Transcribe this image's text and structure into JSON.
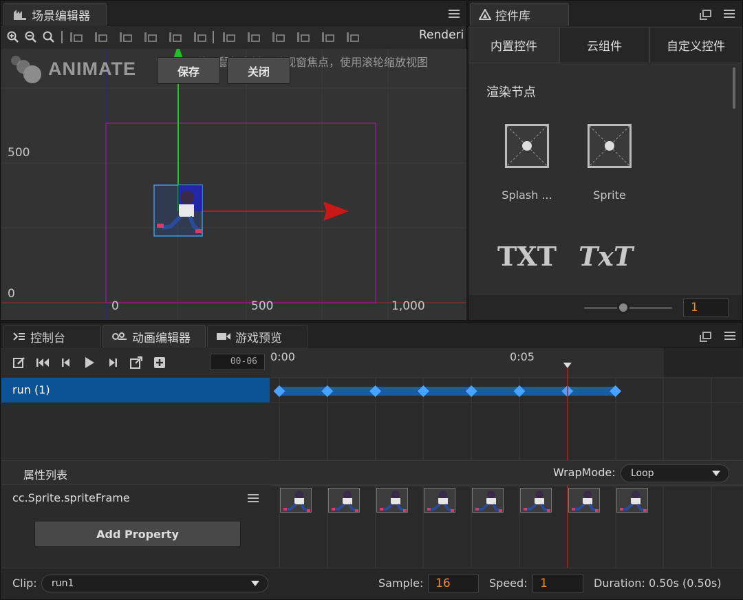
{
  "scene": {
    "tab_title": "场景编辑器",
    "render_label": "Renderi",
    "hint": "使用鼠标右键平移视窗焦点，使用滚轮缩放视图",
    "logo_text": "ANIMATE",
    "save_label": "保存",
    "close_label": "关闭",
    "axis": {
      "y_500": "500",
      "y_0": "0",
      "x_0": "0",
      "x_500": "500",
      "x_1000": "1,000"
    }
  },
  "library": {
    "tab_title": "控件库",
    "tabs": [
      {
        "label": "内置控件"
      },
      {
        "label": "云组件"
      },
      {
        "label": "自定义控件"
      }
    ],
    "section": "渲染节点",
    "components": [
      {
        "label": "Splash ..."
      },
      {
        "label": "Sprite"
      }
    ],
    "text_icons": [
      "TXT",
      "TxT"
    ],
    "zoom_value": "1"
  },
  "bottom": {
    "tabs": [
      {
        "label": "控制台"
      },
      {
        "label": "动画编辑器"
      },
      {
        "label": "游戏预览"
      }
    ]
  },
  "animation": {
    "frame": "00-06",
    "ruler": {
      "start": "0:00",
      "mid": "0:05"
    },
    "node_label": "run (1)",
    "props_title": "属性列表",
    "wrapmode_label": "WrapMode:",
    "wrapmode_value": "Loop",
    "property_name": "cc.Sprite.spriteFrame",
    "add_property": "Add Property",
    "clip_label": "Clip:",
    "clip_value": "run1",
    "sample_label": "Sample:",
    "sample_value": "16",
    "speed_label": "Speed:",
    "speed_value": "1",
    "duration": "Duration: 0.50s (0.50s)",
    "keyframe_count": 8,
    "current_frame": 6,
    "colors": {
      "accent": "#0b5394",
      "keyframe": "#4aa3ff",
      "playhead": "#b02020",
      "number": "#f08a24"
    }
  }
}
